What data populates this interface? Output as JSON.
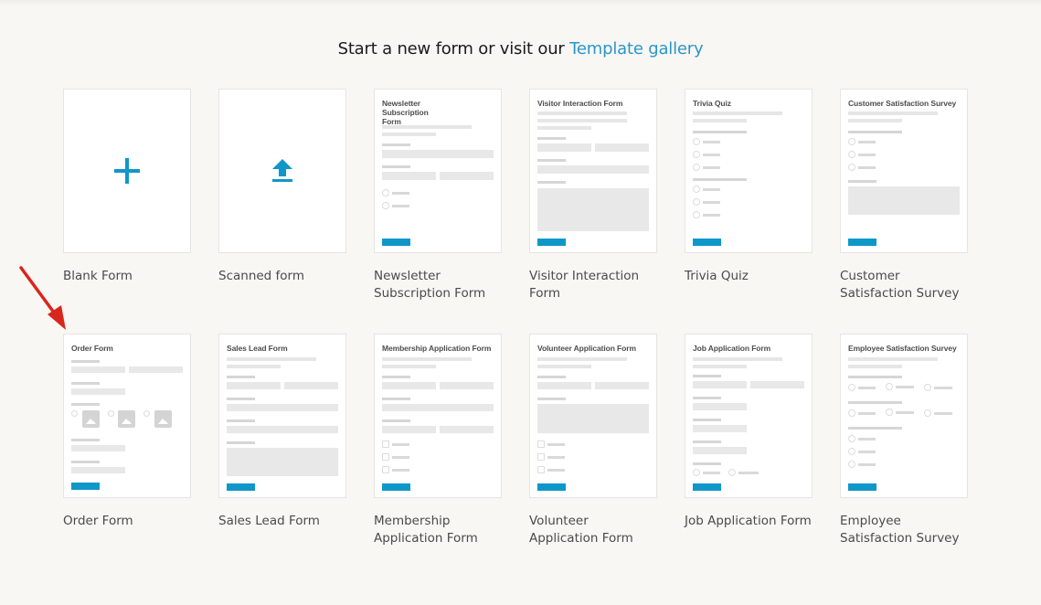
{
  "heading": {
    "prefix": "Start a new form or visit our ",
    "link": "Template gallery"
  },
  "colors": {
    "accent": "#0f97c9",
    "link": "#2b96c8",
    "background": "#f8f7f4",
    "annotation_arrow": "#d9261c"
  },
  "tiles": [
    {
      "label": "Blank Form",
      "icon": "plus-icon"
    },
    {
      "label": "Scanned form",
      "icon": "upload-icon"
    },
    {
      "label": "Newsletter Subscription Form",
      "preview_title": "Newsletter Subscription Form"
    },
    {
      "label": "Visitor Interaction Form",
      "preview_title": "Visitor Interaction Form"
    },
    {
      "label": "Trivia Quiz",
      "preview_title": "Trivia Quiz"
    },
    {
      "label": "Customer Satisfaction Survey",
      "preview_title": "Customer Satisfaction Survey"
    },
    {
      "label": "Order Form",
      "preview_title": "Order Form"
    },
    {
      "label": "Sales Lead Form",
      "preview_title": "Sales Lead Form"
    },
    {
      "label": "Membership Application Form",
      "preview_title": "Membership Application Form"
    },
    {
      "label": "Volunteer Application Form",
      "preview_title": "Volunteer Application Form"
    },
    {
      "label": "Job Application Form",
      "preview_title": "Job Application Form"
    },
    {
      "label": "Employee Satisfaction Survey",
      "preview_title": "Employee Satisfaction Survey"
    }
  ],
  "annotation": {
    "type": "red-arrow",
    "target": "Order Form"
  }
}
